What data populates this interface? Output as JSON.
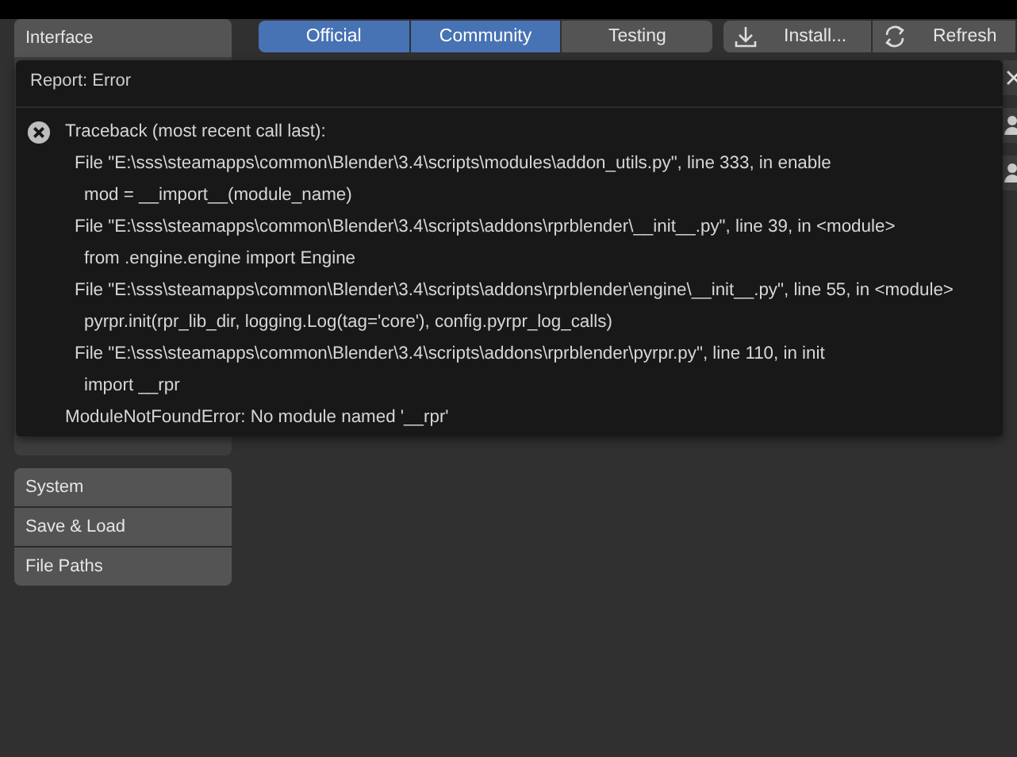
{
  "sidebar": {
    "groups": [
      {
        "items": [
          {
            "label": "Interface"
          }
        ]
      },
      {
        "items": [
          {
            "label": "System"
          },
          {
            "label": "Save & Load"
          },
          {
            "label": "File Paths"
          }
        ]
      }
    ]
  },
  "filter_tabs": [
    {
      "label": "Official",
      "selected": true
    },
    {
      "label": "Community",
      "selected": true
    },
    {
      "label": "Testing",
      "selected": false
    }
  ],
  "toolbar_buttons": [
    {
      "kind": "download",
      "label": "Install..."
    },
    {
      "kind": "refresh",
      "label": "Refresh"
    }
  ],
  "report": {
    "title": "Report: Error",
    "lines": [
      {
        "kind": "heading",
        "text": "Traceback (most recent call last):"
      },
      {
        "kind": "file",
        "text": "File \"E:\\sss\\steamapps\\common\\Blender\\3.4\\scripts\\modules\\addon_utils.py\", line 333, in enable"
      },
      {
        "kind": "code",
        "text": "mod = __import__(module_name)"
      },
      {
        "kind": "file",
        "text": "File \"E:\\sss\\steamapps\\common\\Blender\\3.4\\scripts\\addons\\rprblender\\__init__.py\", line 39, in <module>"
      },
      {
        "kind": "code",
        "text": "from .engine.engine import Engine"
      },
      {
        "kind": "file",
        "text": "File \"E:\\sss\\steamapps\\common\\Blender\\3.4\\scripts\\addons\\rprblender\\engine\\__init__.py\", line 55, in <module>"
      },
      {
        "kind": "code",
        "text": "pyrpr.init(rpr_lib_dir, logging.Log(tag='core'), config.pyrpr_log_calls)"
      },
      {
        "kind": "file",
        "text": "File \"E:\\sss\\steamapps\\common\\Blender\\3.4\\scripts\\addons\\rprblender\\pyrpr.py\", line 110, in init"
      },
      {
        "kind": "code",
        "text": "import __rpr"
      },
      {
        "kind": "error",
        "text": "ModuleNotFoundError: No module named '__rpr'"
      }
    ]
  }
}
